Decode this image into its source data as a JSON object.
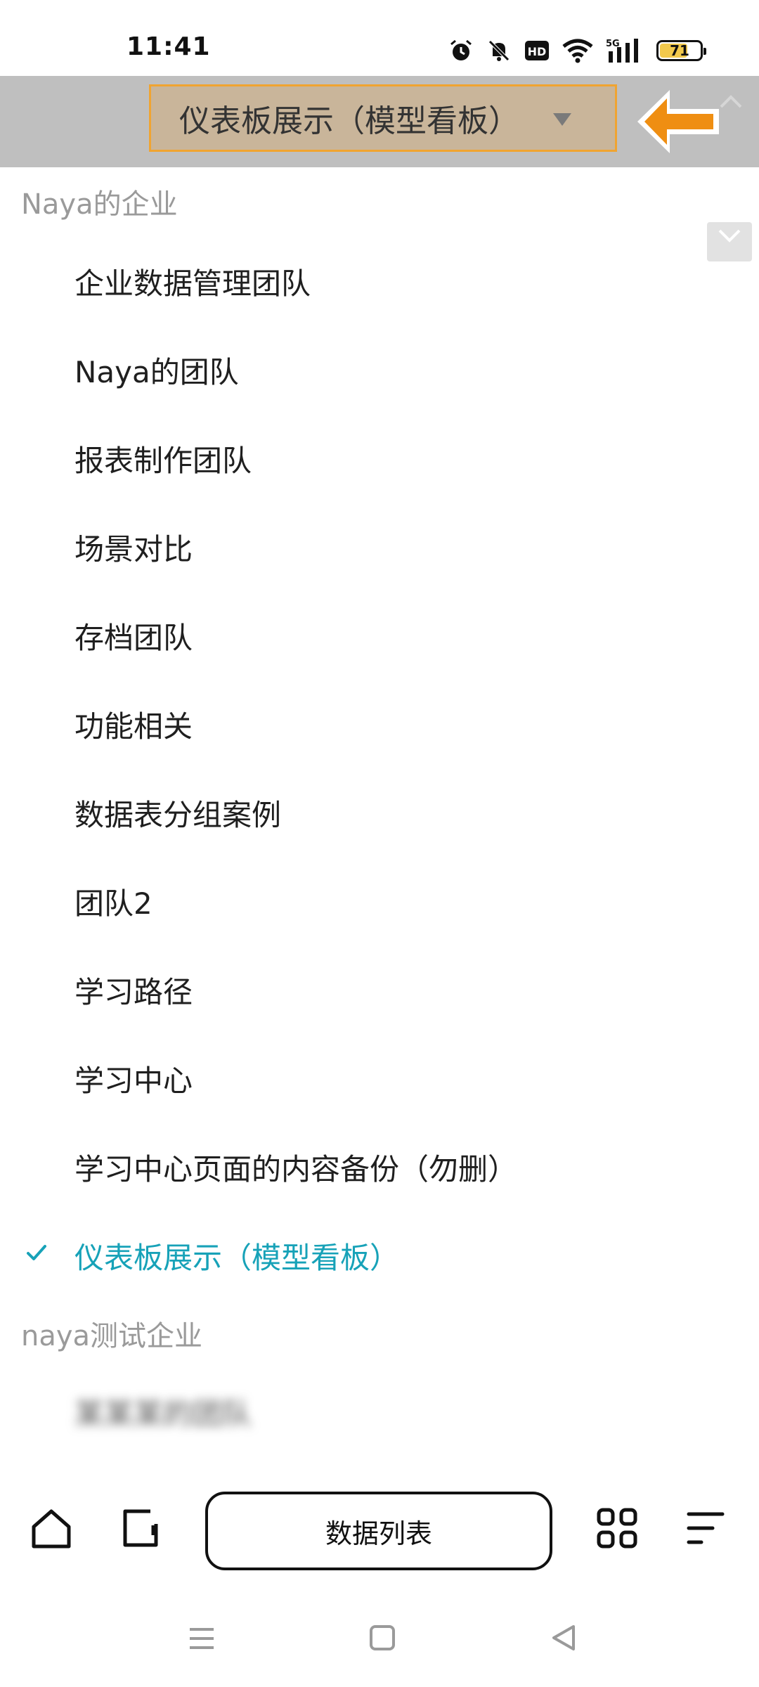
{
  "status_bar": {
    "time": "11:41",
    "network": "5G",
    "hd_badge": "HD",
    "battery_percent": "71",
    "battery_level": 0.71,
    "icons": [
      "alarm-icon",
      "mute-icon",
      "hd-icon",
      "wifi-icon",
      "signal-icon",
      "battery-icon"
    ]
  },
  "header": {
    "selector_label": "仪表板展示（模型看板）",
    "accent_color": "#f0a431",
    "icons": [
      "dropdown-caret-icon",
      "back-arrow-icon",
      "scroll-up-icon",
      "scroll-down-icon"
    ]
  },
  "list": {
    "selected_color": "#17a2b8",
    "org1": {
      "name": "Naya的企业",
      "teams": [
        "企业数据管理团队",
        "Naya的团队",
        "报表制作团队",
        "场景对比",
        "存档团队",
        "功能相关",
        "数据表分组案例",
        "团队2",
        "学习路径",
        "学习中心",
        "学习中心页面的内容备份（勿删）"
      ],
      "selected_team": "仪表板展示（模型看板）"
    },
    "org2": {
      "name": "naya测试企业",
      "blurred_team": "某某某的团队"
    }
  },
  "bottom_toolbar": {
    "data_list_label": "数据列表",
    "icons": [
      "home-icon",
      "page-icon",
      "grid-icon",
      "menu-icon"
    ]
  },
  "system_nav": {
    "icons": [
      "recent-apps-icon",
      "home-square-icon",
      "back-triangle-icon"
    ]
  }
}
